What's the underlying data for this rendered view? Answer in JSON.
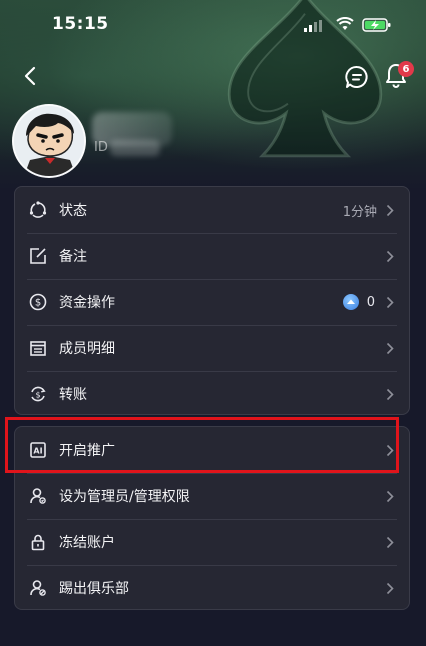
{
  "status_bar": {
    "time": "15:15"
  },
  "header": {
    "notification_count": "6",
    "user_id_label": "ID"
  },
  "menu_group_1": [
    {
      "label": "状态",
      "value": "1分钟",
      "icon": "status-icon"
    },
    {
      "label": "备注",
      "value": "",
      "icon": "edit-note-icon"
    },
    {
      "label": "资金操作",
      "value": "0",
      "icon": "dollar-icon"
    },
    {
      "label": "成员明细",
      "value": "",
      "icon": "member-detail-icon"
    },
    {
      "label": "转账",
      "value": "",
      "icon": "transfer-icon"
    }
  ],
  "menu_group_2": [
    {
      "label": "开启推广",
      "icon": "ai-icon"
    },
    {
      "label": "设为管理员/管理权限",
      "icon": "admin-user-icon"
    },
    {
      "label": "冻结账户",
      "icon": "lock-icon"
    },
    {
      "label": "踢出俱乐部",
      "icon": "kick-user-icon"
    }
  ],
  "colors": {
    "background": "#17192a",
    "card": "#262733",
    "badge": "#e2394a",
    "highlight": "#e0141b",
    "coin": "#3a7ee0"
  }
}
